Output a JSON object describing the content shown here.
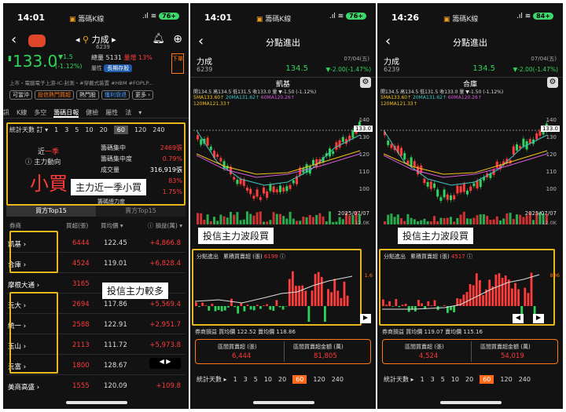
{
  "status": {
    "p1_time": "14:01",
    "p2_time": "14:01",
    "p3_time": "14:26",
    "app": "籌碼K線",
    "batt1": "76+",
    "batt2": "76+",
    "batt3": "84+"
  },
  "p1": {
    "stock_name": "力成",
    "stock_code": "6239",
    "price": "133.0",
    "change": "▼1.5",
    "change_pct": "(-1.12%)",
    "vol_label": "總量",
    "vol": "5131",
    "ratio_label": "量增",
    "ratio": "13%",
    "tag1": "屬性",
    "tag2": "長期存股",
    "sell_btn": "下單",
    "industry": "上市・電腦電子上游-IC-封測・#穿戴式裝置 #HBM #FOPLP...",
    "chips": [
      "可當沖",
      "投信熱門買超",
      "熱門股",
      "獲利衰退",
      "更多 ›"
    ],
    "tabs": [
      "訊",
      "K線",
      "多空",
      "籌碼日報",
      "健檢",
      "屬性",
      "法"
    ],
    "days_label": "統計天數 訂 ▾",
    "days": [
      "1",
      "3",
      "5",
      "10",
      "20",
      "60",
      "120",
      "240"
    ],
    "recent": "近一季",
    "recent_hl": "一季",
    "main_dir": "ⓘ 主力動向",
    "big_text": "小買",
    "stats": [
      {
        "k": "籌碼集中",
        "v": "2469張"
      },
      {
        "k": "籌碼集中度",
        "v": "0.79%"
      },
      {
        "k": "成交量",
        "v": "316,919張"
      },
      {
        "k": "",
        "v": "83%"
      },
      {
        "k": "籌碼總力度",
        "v": "1.75%"
      }
    ],
    "label_main": "主力近一季小買",
    "tab_buy": "買方Top15",
    "tab_sell": "賣方Top15",
    "headers": [
      "券商",
      "買超(張)",
      "買均價 ▾",
      "ⓘ 損益(萬) ▾"
    ],
    "rows": [
      {
        "name": "凱基 ›",
        "buy": "6444",
        "avg": "122.45",
        "pl": "+4,866.8"
      },
      {
        "name": "合庫 ›",
        "buy": "4524",
        "avg": "119.01",
        "pl": "+6,828.4"
      },
      {
        "name": "摩根大通 ›",
        "buy": "3165",
        "avg": "",
        "pl": ""
      },
      {
        "name": "元大 ›",
        "buy": "2694",
        "avg": "117.86",
        "pl": "+5,569.4"
      },
      {
        "name": "統一 ›",
        "buy": "2588",
        "avg": "122.91",
        "pl": "+2,951.7"
      },
      {
        "name": "玉山 ›",
        "buy": "2113",
        "avg": "111.72",
        "pl": "+5,973.8"
      },
      {
        "name": "元富 ›",
        "buy": "1800",
        "avg": "128.67",
        "pl": "+"
      },
      {
        "name": "美商高盛 ›",
        "buy": "1555",
        "avg": "120.09",
        "pl": "+109.8"
      }
    ],
    "label_invest": "投信主力較多"
  },
  "p2": {
    "title": "分點進出",
    "stock_name": "力成",
    "stock_code": "6239",
    "date": "07/04(五)",
    "price": "134.5",
    "chg": "▼-2.00(-1.47%)",
    "broker": "凱基",
    "ohlc": "開134.5 高134.5 低131.5 收133.0 量 ▼-1.50 (-1.12%)",
    "ma1": "5MA133.60↑",
    "ma2": "20MA131.62↑",
    "ma3": "60MA120.26↑",
    "ma4": "120MA121.33↑",
    "price_tag": "133.0",
    "yticks": [
      "140",
      "130",
      "120",
      "110",
      "100"
    ],
    "chart_date": "2025/07/07",
    "vol_tick": "12.0K",
    "label": "投信主力波段買",
    "sub_title": "分點進出",
    "sub_legend": "累積買賣超 (張)",
    "sub_val": "6199",
    "sub_tick": "1.6",
    "footer": "券商損益",
    "footer_v": "買均價 122.52 賣均價 118.86",
    "box_k1": "區間買賣超 (張)",
    "box_v1": "6,444",
    "box_k2": "區間買賣超金額 (萬)",
    "box_v2": "81,805",
    "days_label": "統計天數 ▸",
    "days": [
      "1",
      "3",
      "5",
      "10",
      "20",
      "60",
      "120",
      "240"
    ]
  },
  "p3": {
    "title": "分點進出",
    "stock_name": "力成",
    "stock_code": "6239",
    "date": "07/04(五)",
    "price": "134.5",
    "chg": "▼-2.00(-1.47%)",
    "broker": "合庫",
    "ohlc": "開134.5 高134.5 低131.5 收133.0 量 ▼-1.50 (-1.12%)",
    "ma1": "5MA133.60↑",
    "ma2": "20MA131.62↑",
    "ma3": "60MA120.26↑",
    "ma4": "120MA121.33↑",
    "price_tag": "133.0",
    "yticks": [
      "140",
      "130",
      "120",
      "110",
      "100"
    ],
    "chart_date": "2025/07/07",
    "vol_tick": "12.0K",
    "label": "投信主力波段買",
    "sub_title": "分點進出",
    "sub_legend": "累積買賣超 (張)",
    "sub_val": "4517",
    "sub_tick": "806",
    "footer": "券商損益",
    "footer_v": "買均價 119.07 賣均價 115.16",
    "box_k1": "區間買賣超 (張)",
    "box_v1": "4,524",
    "box_k2": "區間買賣超金額 (萬)",
    "box_v2": "54,019",
    "days_label": "統計天數 ▸",
    "days": [
      "1",
      "3",
      "5",
      "10",
      "20",
      "60",
      "120",
      "240"
    ]
  }
}
